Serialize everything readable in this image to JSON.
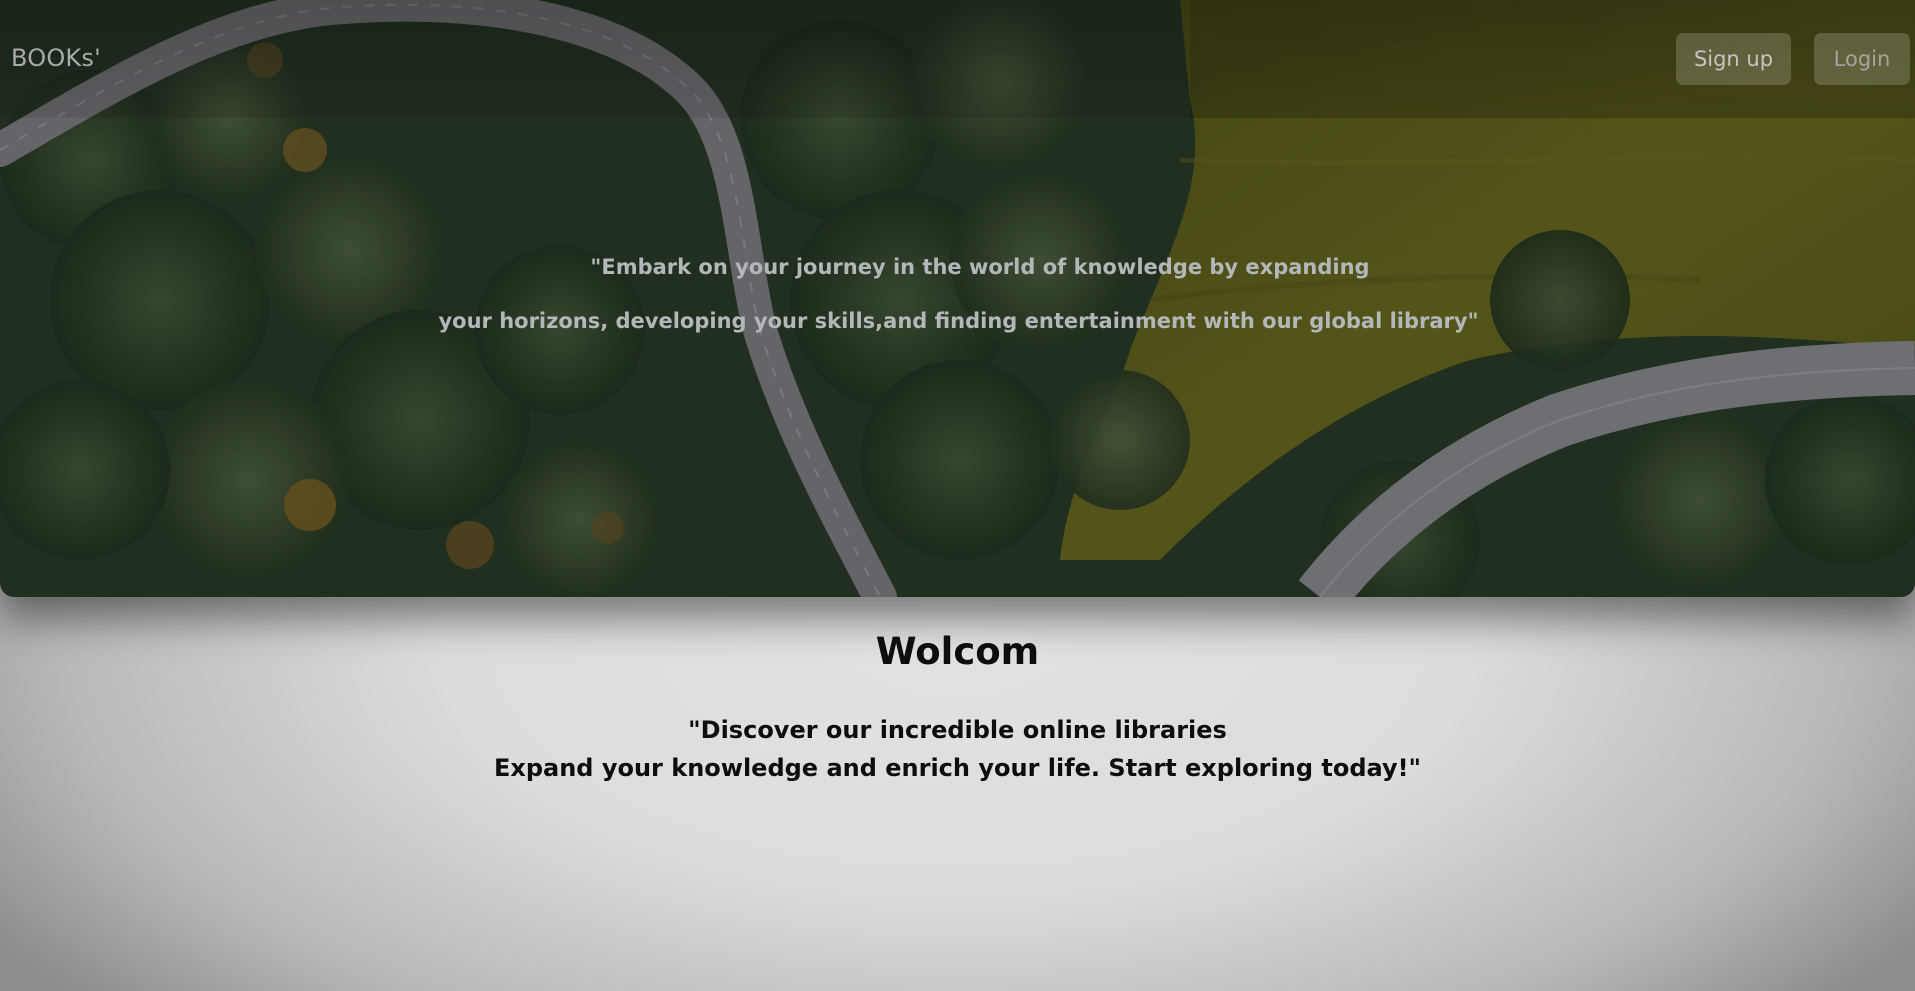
{
  "header": {
    "brand": "BOOKs'",
    "signup_label": "Sign up",
    "login_label": "Login"
  },
  "hero": {
    "background": "aerial-forest-road-photo",
    "quote_line1": "\"Embark on your journey in the world of knowledge by expanding",
    "quote_line2": "your horizons, developing your skills,and finding entertainment with our global library\""
  },
  "main": {
    "heading": "Wolcom",
    "intro_line1": "\"Discover our incredible online libraries",
    "intro_line2": "Expand your knowledge and enrich your life. Start exploring today!\""
  },
  "colors": {
    "page_background": "#dcdcdc",
    "forest": "#2f4328",
    "meadow": "#6b6b1c",
    "road": "#8d8c90",
    "hero_text": "#b3b7ba",
    "body_text": "#0d0d0d"
  }
}
